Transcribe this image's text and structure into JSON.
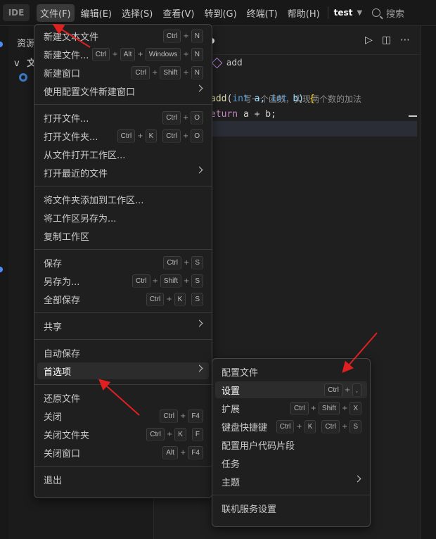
{
  "colors": {
    "accent": "#4c8df6",
    "annotation_arrow": "#e02020"
  },
  "menubar": {
    "badge": "IDE",
    "items": [
      "文件(F)",
      "编辑(E)",
      "选择(S)",
      "查看(V)",
      "转到(G)",
      "终端(T)",
      "帮助(H)"
    ],
    "project": "test",
    "search_label": "搜索"
  },
  "explorer": {
    "title": "资源",
    "folder_label": "文",
    "folder_caret": "v"
  },
  "editor": {
    "breadcrumb": "add",
    "comment": "写一个函数，实现两个数的加法",
    "line1": {
      "fn": "add",
      "p1": "(",
      "int1": "int",
      "a": " a, ",
      "int2": "int",
      "b": " b) ",
      "brace": "{"
    },
    "line2": {
      "kw": "eturn",
      "rest": " a + b;"
    },
    "toolbar_icons": [
      "run-icon",
      "split-editor-icon",
      "more-icon"
    ]
  },
  "file_menu": {
    "new_text_file": {
      "label": "新建文本文件",
      "keys": [
        "Ctrl",
        "N"
      ]
    },
    "new_file": {
      "label": "新建文件...",
      "keys": [
        "Ctrl",
        "Alt",
        "Windows",
        "N"
      ]
    },
    "new_window": {
      "label": "新建窗口",
      "keys": [
        "Ctrl",
        "Shift",
        "N"
      ]
    },
    "new_window_profile": {
      "label": "使用配置文件新建窗口"
    },
    "open_file": {
      "label": "打开文件...",
      "keys": [
        "Ctrl",
        "O"
      ]
    },
    "open_folder": {
      "label": "打开文件夹...",
      "chord1": [
        "Ctrl",
        "K"
      ],
      "chord2": [
        "Ctrl",
        "O"
      ]
    },
    "open_workspace": {
      "label": "从文件打开工作区..."
    },
    "open_recent": {
      "label": "打开最近的文件"
    },
    "add_folder": {
      "label": "将文件夹添加到工作区..."
    },
    "save_workspace_as": {
      "label": "将工作区另存为..."
    },
    "duplicate_workspace": {
      "label": "复制工作区"
    },
    "save": {
      "label": "保存",
      "keys": [
        "Ctrl",
        "S"
      ]
    },
    "save_as": {
      "label": "另存为...",
      "keys": [
        "Ctrl",
        "Shift",
        "S"
      ]
    },
    "save_all": {
      "label": "全部保存",
      "chord1": [
        "Ctrl",
        "K"
      ],
      "chord2": [
        "S"
      ]
    },
    "share": {
      "label": "共享"
    },
    "auto_save": {
      "label": "自动保存"
    },
    "preferences": {
      "label": "首选项"
    },
    "revert_file": {
      "label": "还原文件"
    },
    "close": {
      "label": "关闭",
      "keys": [
        "Ctrl",
        "F4"
      ]
    },
    "close_folder": {
      "label": "关闭文件夹",
      "chord1": [
        "Ctrl",
        "K"
      ],
      "chord2": [
        "F"
      ]
    },
    "close_window": {
      "label": "关闭窗口",
      "keys": [
        "Alt",
        "F4"
      ]
    },
    "exit": {
      "label": "退出"
    }
  },
  "pref_menu": {
    "profiles": {
      "label": "配置文件"
    },
    "settings": {
      "label": "设置",
      "keys": [
        "Ctrl",
        ","
      ]
    },
    "extensions": {
      "label": "扩展",
      "keys": [
        "Ctrl",
        "Shift",
        "X"
      ]
    },
    "keyboard_shortcuts": {
      "label": "键盘快捷键",
      "chord1": [
        "Ctrl",
        "K"
      ],
      "chord2": [
        "Ctrl",
        "S"
      ]
    },
    "user_snippets": {
      "label": "配置用户代码片段"
    },
    "tasks": {
      "label": "任务"
    },
    "themes": {
      "label": "主题"
    },
    "online_services": {
      "label": "联机服务设置"
    }
  }
}
